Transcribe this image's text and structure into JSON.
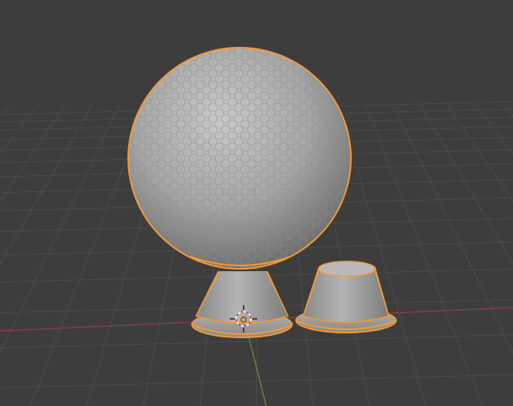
{
  "viewport": {
    "mode": "3d-viewport-solid-shading",
    "background_color": "#3d3d3d",
    "grid_color": "#4a4a4a",
    "x_axis_color": "#8f3c44",
    "y_axis_color": "#6a8f2e",
    "selection_outline_color": "#f29a32",
    "mesh_color": "#a9a9a9"
  },
  "objects": [
    {
      "name": "golf-ball",
      "type": "mesh",
      "selected": true
    },
    {
      "name": "golf-tee",
      "type": "mesh",
      "selected": true
    },
    {
      "name": "tee-cap",
      "type": "mesh",
      "selected": true
    }
  ],
  "cursor": {
    "icon": "3d-cursor-icon"
  },
  "origin": {
    "icon": "object-origin-icon"
  }
}
